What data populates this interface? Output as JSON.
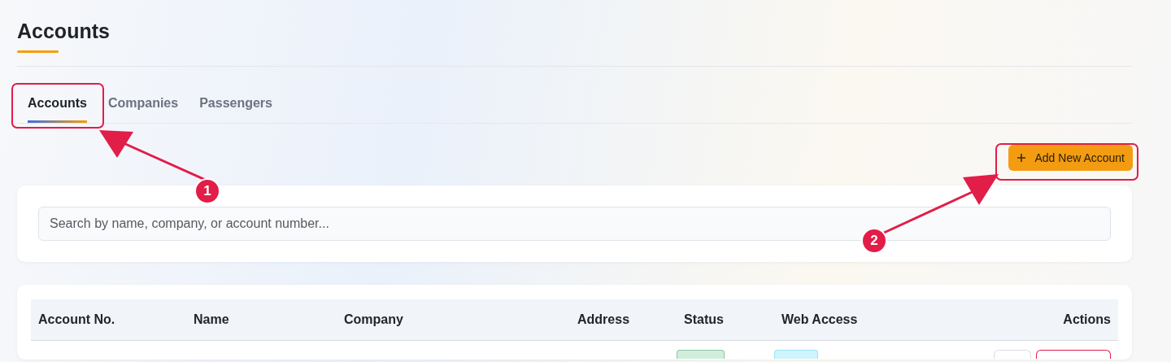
{
  "page_title": "Accounts",
  "tabs": [
    {
      "label": "Accounts",
      "selected": true
    },
    {
      "label": "Companies",
      "selected": false
    },
    {
      "label": "Passengers",
      "selected": false
    }
  ],
  "add_button": {
    "label": "Add New Account"
  },
  "search": {
    "placeholder": "Search by name, company, or account number..."
  },
  "table": {
    "columns": [
      {
        "label": "Account No."
      },
      {
        "label": "Name"
      },
      {
        "label": "Company"
      },
      {
        "label": "Address"
      },
      {
        "label": "Status"
      },
      {
        "label": "Web Access"
      },
      {
        "label": "Actions"
      }
    ]
  },
  "annotations": [
    {
      "number": "1"
    },
    {
      "number": "2"
    }
  ]
}
